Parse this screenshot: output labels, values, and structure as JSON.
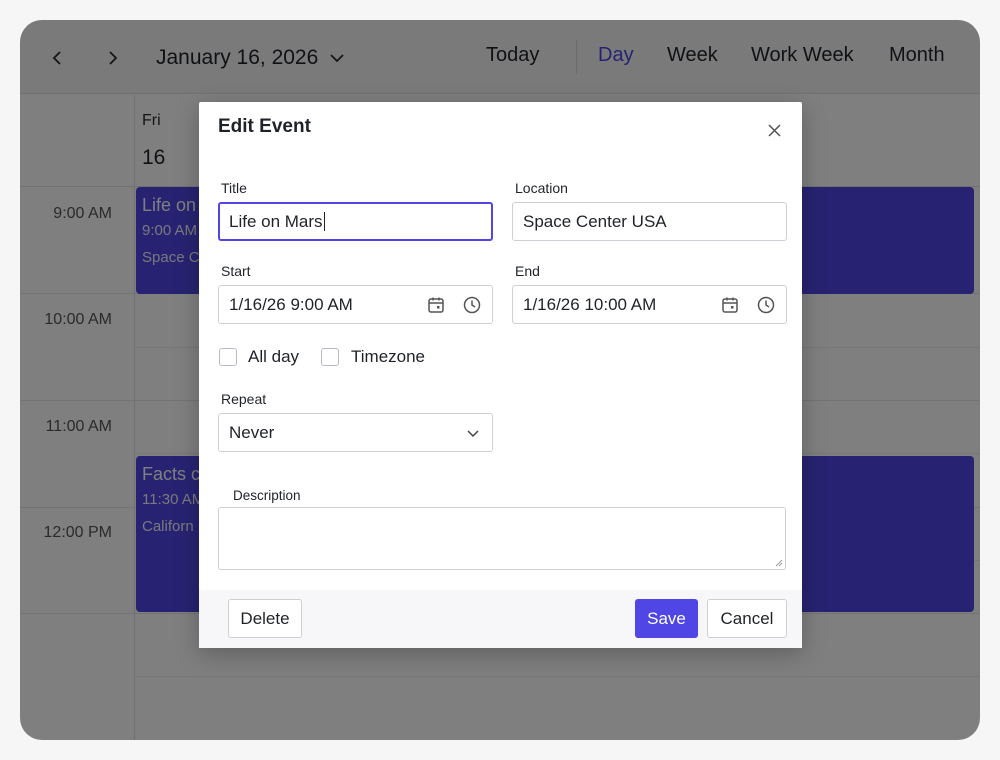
{
  "toolbar": {
    "date": "January 16, 2026",
    "today": "Today",
    "views": [
      "Day",
      "Week",
      "Work Week",
      "Month"
    ],
    "active_view": "Day"
  },
  "calendar": {
    "day_name": "Fri",
    "day_number": "16",
    "time_slots": [
      "9:00 AM",
      "10:00 AM",
      "11:00 AM",
      "12:00 PM"
    ],
    "events": [
      {
        "title": "Life on",
        "time": "9:00 AM",
        "location": "Space C"
      },
      {
        "title": "Facts c",
        "time": "11:30 AM",
        "location": "Californ"
      }
    ]
  },
  "dialog": {
    "title": "Edit Event",
    "title_label": "Title",
    "title_value": "Life on Mars",
    "location_label": "Location",
    "location_value": "Space Center USA",
    "start_label": "Start",
    "start_value": "1/16/26 9:00 AM",
    "end_label": "End",
    "end_value": "1/16/26 10:00 AM",
    "all_day_label": "All day",
    "all_day_checked": false,
    "timezone_label": "Timezone",
    "timezone_checked": false,
    "repeat_label": "Repeat",
    "repeat_value": "Never",
    "description_label": "Description",
    "description_value": "",
    "delete_label": "Delete",
    "save_label": "Save",
    "cancel_label": "Cancel"
  },
  "colors": {
    "accent": "#4f46e5",
    "event": "#4f46e5",
    "overlay": "rgba(0,0,0,0.5)"
  }
}
